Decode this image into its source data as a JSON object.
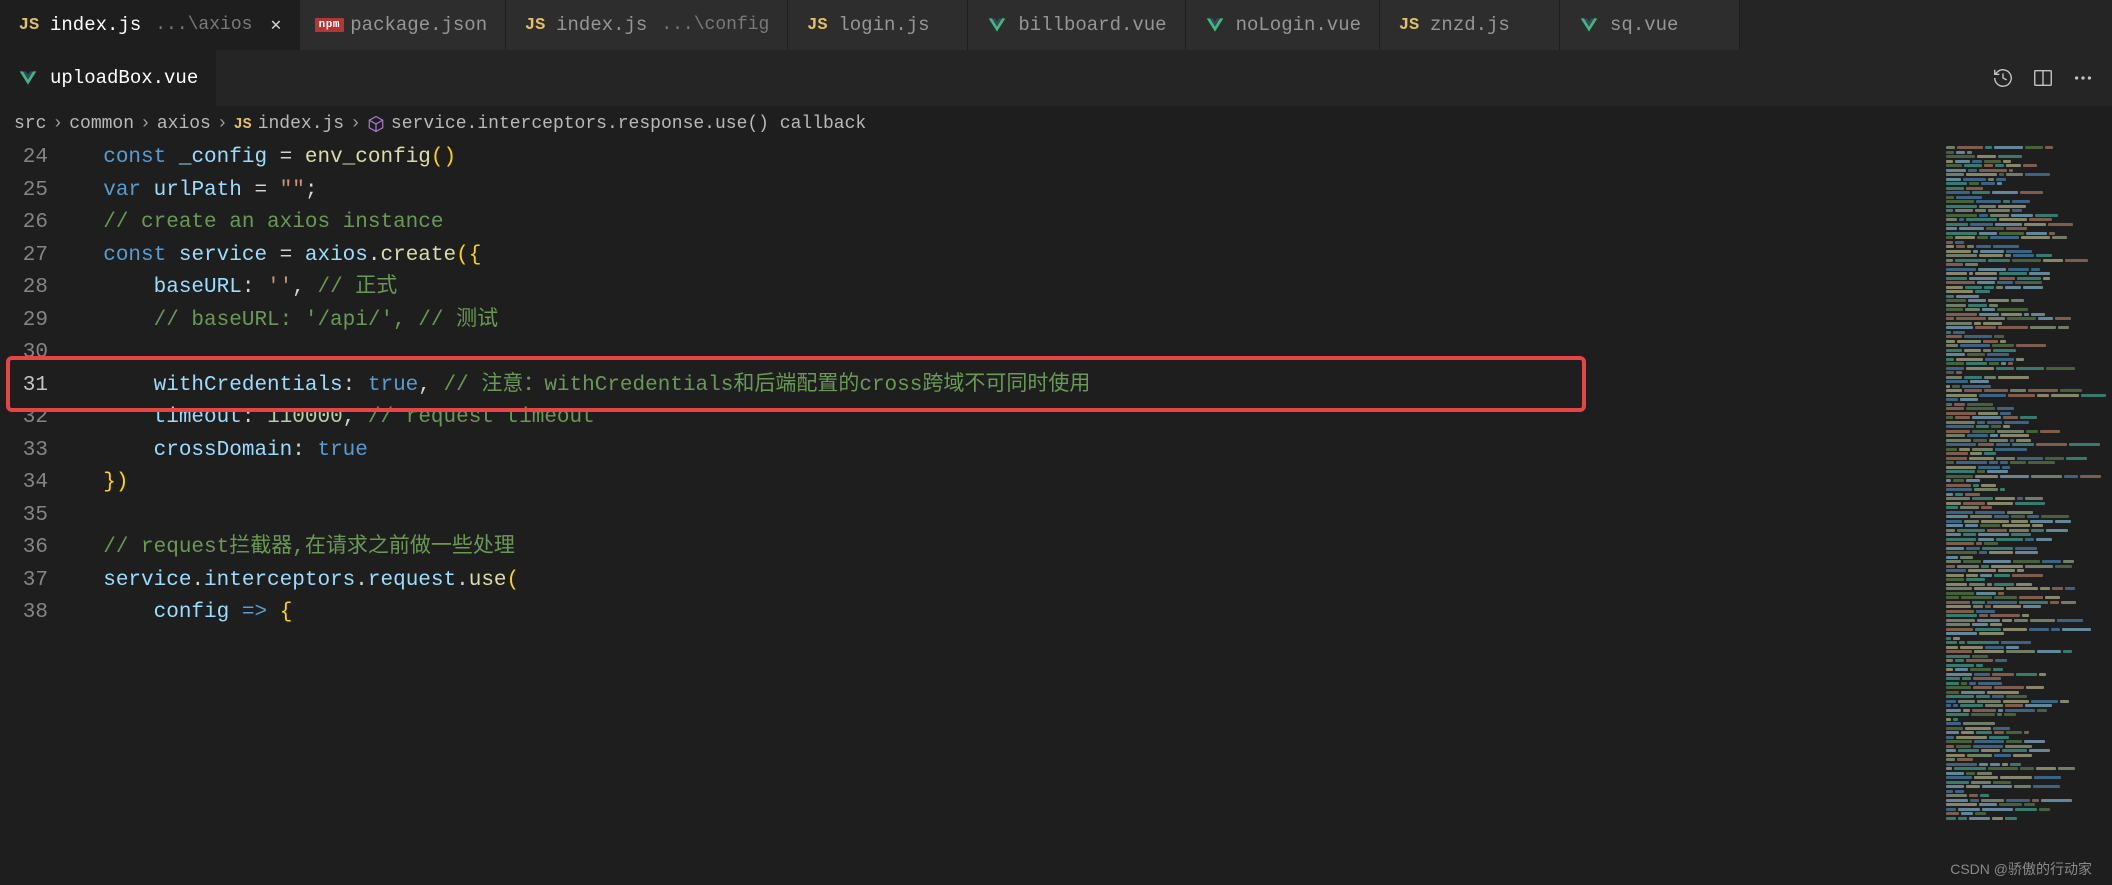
{
  "tabs_row1": [
    {
      "icon": "js",
      "label": "index.js",
      "suffix": "...\\axios",
      "active": true,
      "close": true
    },
    {
      "icon": "npm",
      "label": "package.json"
    },
    {
      "icon": "js",
      "label": "index.js",
      "suffix": "...\\config"
    },
    {
      "icon": "js",
      "label": "login.js"
    },
    {
      "icon": "vue",
      "label": "billboard.vue"
    },
    {
      "icon": "vue",
      "label": "noLogin.vue"
    },
    {
      "icon": "js",
      "label": "znzd.js"
    },
    {
      "icon": "vue",
      "label": "sq.vue"
    }
  ],
  "tabs_row2": [
    {
      "icon": "vue",
      "label": "uploadBox.vue"
    }
  ],
  "breadcrumb": {
    "items": [
      "src",
      "common",
      "axios"
    ],
    "file": "index.js",
    "symbol": "service.interceptors.response.use() callback"
  },
  "line_start": 24,
  "code_lines": [
    {
      "n": 24,
      "tokens": [
        [
          "kw",
          "const "
        ],
        [
          "var",
          "_config"
        ],
        [
          "punc",
          " = "
        ],
        [
          "fn",
          "env_config"
        ],
        [
          "paren",
          "()"
        ]
      ]
    },
    {
      "n": 25,
      "tokens": [
        [
          "kw",
          "var "
        ],
        [
          "var",
          "urlPath"
        ],
        [
          "punc",
          " = "
        ],
        [
          "str",
          "\"\""
        ],
        [
          "punc",
          ";"
        ]
      ]
    },
    {
      "n": 26,
      "tokens": [
        [
          "cmt",
          "// create an axios instance"
        ]
      ]
    },
    {
      "n": 27,
      "tokens": [
        [
          "kw",
          "const "
        ],
        [
          "var",
          "service"
        ],
        [
          "punc",
          " = "
        ],
        [
          "var",
          "axios"
        ],
        [
          "punc",
          "."
        ],
        [
          "fn",
          "create"
        ],
        [
          "paren",
          "({"
        ]
      ]
    },
    {
      "n": 28,
      "indent": 1,
      "tokens": [
        [
          "prop",
          "baseURL"
        ],
        [
          "punc",
          ": "
        ],
        [
          "str",
          "''"
        ],
        [
          "punc",
          ", "
        ],
        [
          "cmt",
          "// 正式"
        ]
      ]
    },
    {
      "n": 29,
      "indent": 1,
      "tokens": [
        [
          "cmt",
          "// baseURL: '/api/', // 测试"
        ]
      ]
    },
    {
      "n": 30,
      "tokens": []
    },
    {
      "n": 31,
      "indent": 1,
      "highlight": true,
      "tokens": [
        [
          "prop",
          "withCredentials"
        ],
        [
          "punc",
          ": "
        ],
        [
          "bool",
          "true"
        ],
        [
          "punc",
          ", "
        ],
        [
          "cmt",
          "// 注意：withCredentials和后端配置的cross跨域不可同时使用"
        ]
      ]
    },
    {
      "n": 32,
      "indent": 1,
      "tokens": [
        [
          "prop",
          "timeout"
        ],
        [
          "punc",
          ": "
        ],
        [
          "num",
          "110000"
        ],
        [
          "punc",
          ", "
        ],
        [
          "cmt",
          "// request timeout"
        ]
      ]
    },
    {
      "n": 33,
      "indent": 1,
      "tokens": [
        [
          "prop",
          "crossDomain"
        ],
        [
          "punc",
          ": "
        ],
        [
          "bool",
          "true"
        ]
      ]
    },
    {
      "n": 34,
      "tokens": [
        [
          "paren",
          "})"
        ]
      ]
    },
    {
      "n": 35,
      "tokens": []
    },
    {
      "n": 36,
      "tokens": [
        [
          "cmt",
          "// request拦截器,在请求之前做一些处理"
        ]
      ]
    },
    {
      "n": 37,
      "tokens": [
        [
          "var",
          "service"
        ],
        [
          "punc",
          "."
        ],
        [
          "var",
          "interceptors"
        ],
        [
          "punc",
          "."
        ],
        [
          "var",
          "request"
        ],
        [
          "punc",
          "."
        ],
        [
          "fn",
          "use"
        ],
        [
          "paren",
          "("
        ]
      ]
    },
    {
      "n": 38,
      "indent": 1,
      "tokens": [
        [
          "var",
          "config"
        ],
        [
          "punc",
          " "
        ],
        [
          "kw",
          "=>"
        ],
        [
          "punc",
          " "
        ],
        [
          "paren",
          "{"
        ]
      ]
    }
  ],
  "watermark": "CSDN @骄傲的行动家"
}
